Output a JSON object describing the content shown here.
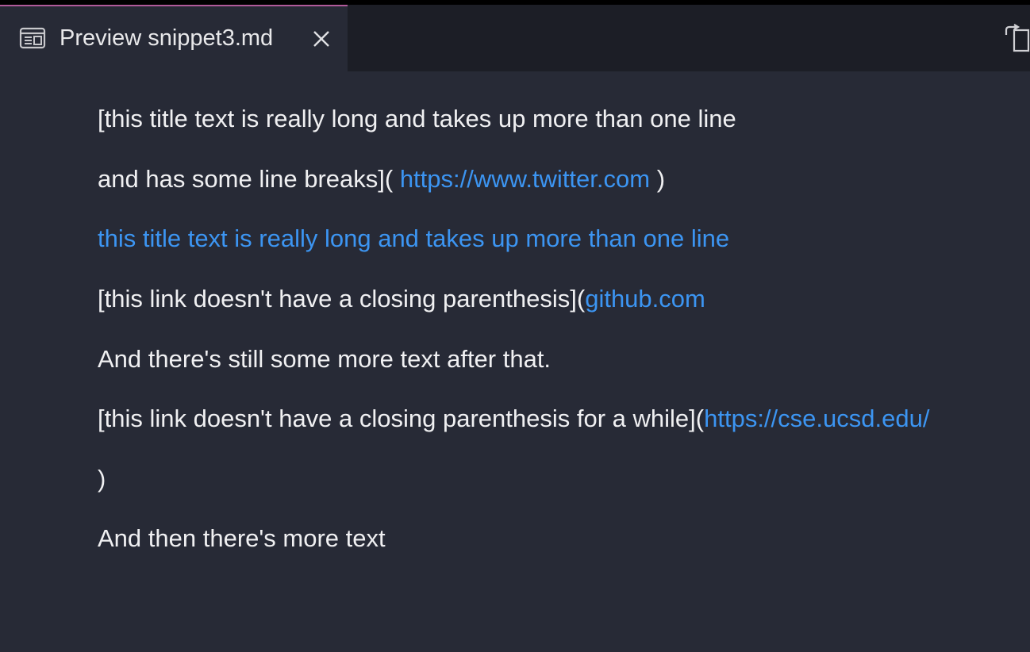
{
  "colors": {
    "background": "#272a36",
    "topbar": "#1c1e26",
    "tab_accent": "#b05a9a",
    "text": "#f0f0f2",
    "link": "#3c95f2"
  },
  "tab": {
    "icon": "preview-icon",
    "label": "Preview snippet3.md",
    "close_icon": "close-icon"
  },
  "toolbar": {
    "split_icon": "open-preview-to-side-icon"
  },
  "preview": {
    "line1": "[this title text is really long and takes up more than one line",
    "line2_prefix": "and has some line breaks](",
    "line2_link": " https://www.twitter.com ",
    "line2_suffix": ")",
    "line3_link": "this title text is really long and takes up more than one line",
    "line4_prefix": "[this link doesn't have a closing parenthesis](",
    "line4_link": "github.com",
    "line5": "And there's still some more text after that.",
    "line6_prefix": "[this link doesn't have a closing parenthesis for a while](",
    "line6_link": "https://cse.ucsd.edu/",
    "line7": ")",
    "line8": "And then there's more text"
  }
}
